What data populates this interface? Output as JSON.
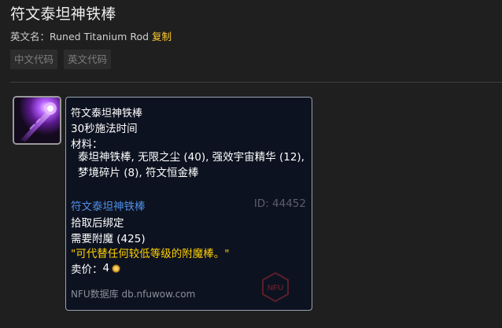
{
  "page": {
    "title": "符文泰坦神铁棒",
    "en_label": "英文名：",
    "en_name": "Runed Titanium Rod",
    "copy_label": "复制",
    "tabs": [
      {
        "label": "中文代码"
      },
      {
        "label": "英文代码"
      }
    ]
  },
  "tooltip": {
    "name": "符文泰坦神铁棒",
    "cast_time": "30秒施法时间",
    "materials_label": "材料：",
    "materials": "泰坦神铁棒, 无限之尘 (40), 强效宇宙精华 (12), 梦境碎片 (8), 符文恒金棒",
    "item_link": "符文泰坦神铁棒",
    "item_id": "ID: 44452",
    "bind": "拾取后绑定",
    "requirement": "需要附魔 (425)",
    "flavor": "\"可代替任何较低等级的附魔棒。\"",
    "sell_label": "卖价：",
    "sell_value": "4",
    "sell_coin_icon": "copper-coin-icon",
    "footer": "NFU数据库 db.nfuwow.com",
    "watermark_icon": "nfu-logo-watermark"
  },
  "colors": {
    "background": "#1f1f1f",
    "tooltip_bg": "#0d1220",
    "tooltip_border": "#98a2b3",
    "link_blue": "#4f8fe6",
    "flavor_gold": "#ffd100",
    "copy_gold": "#ffcc33"
  }
}
